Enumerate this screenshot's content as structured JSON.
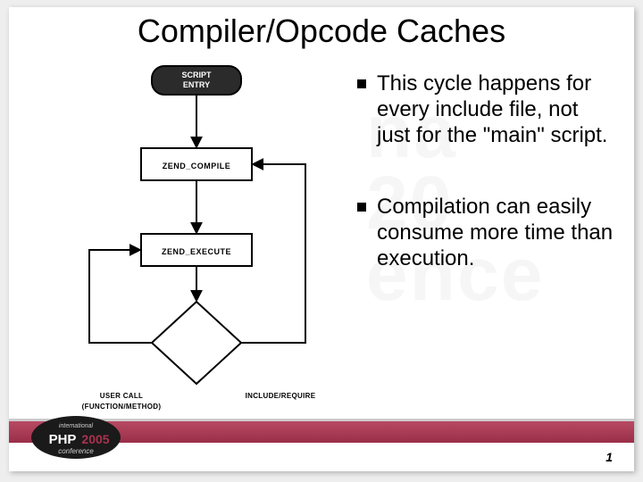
{
  "title": "Compiler/Opcode Caches",
  "watermark": {
    "l1": "na",
    "l2": "20",
    "l3": "ence"
  },
  "bullets": {
    "b1": "This cycle happens for every include file, not just for the \"main\" script.",
    "b2": "Compilation can easily consume more time than execution."
  },
  "flow": {
    "entry_l1": "SCRIPT",
    "entry_l2": "ENTRY",
    "compile": "ZEND_COMPILE",
    "execute": "ZEND_EXECUTE",
    "left_l1": "USER CALL",
    "left_l2": "(FUNCTION/METHOD)",
    "right": "INCLUDE/REQUIRE"
  },
  "footer": {
    "page": "1",
    "logo_l1": "international",
    "logo_l2": "PHP",
    "logo_l3": "2005",
    "logo_l4": "conference"
  }
}
